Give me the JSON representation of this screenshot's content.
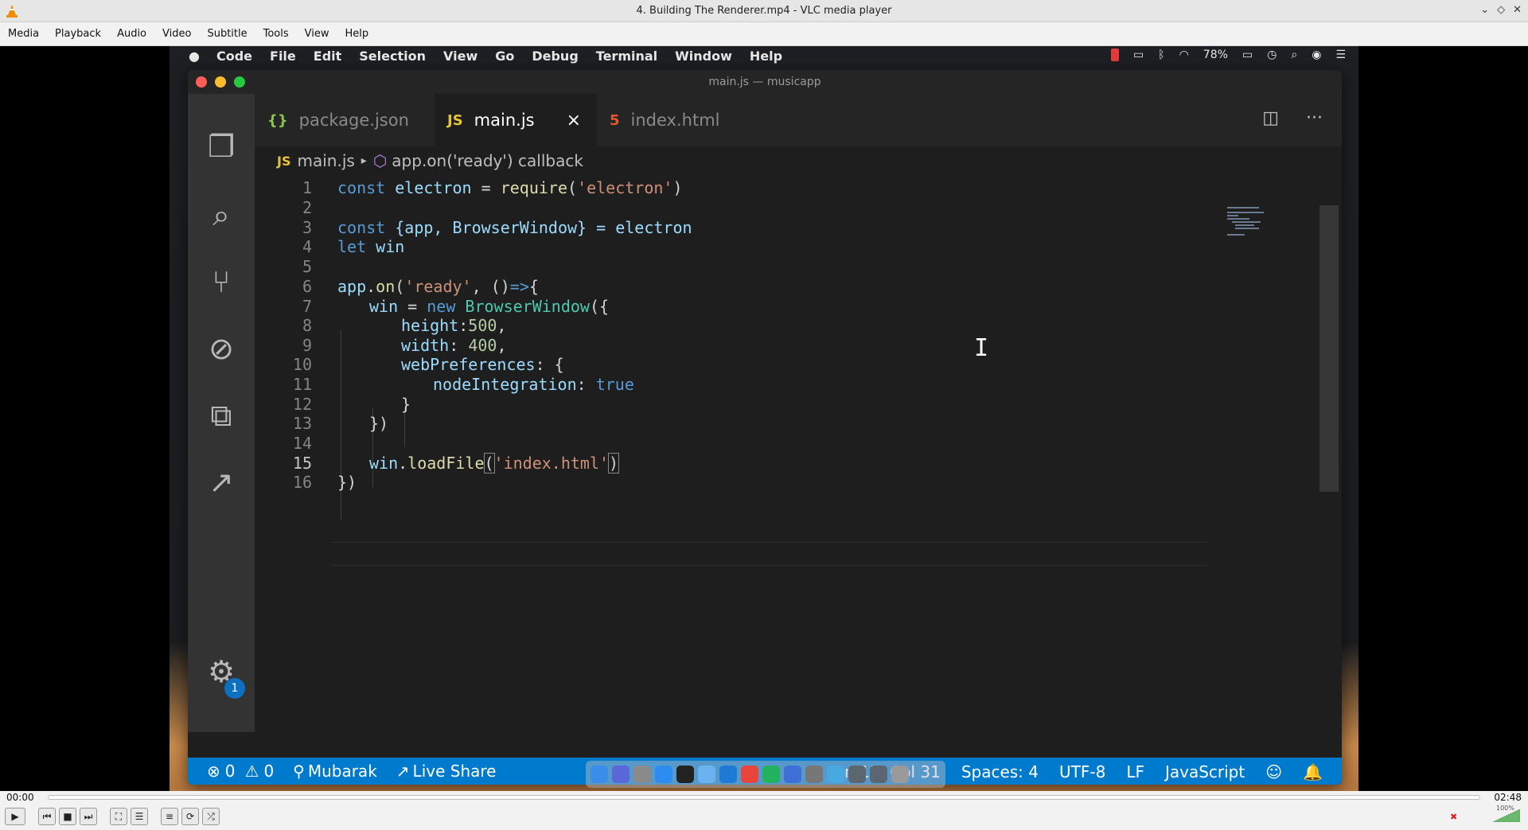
{
  "vlc": {
    "window_title": "4. Building The Renderer.mp4 - VLC media player",
    "menus": [
      "Media",
      "Playback",
      "Audio",
      "Video",
      "Subtitle",
      "Tools",
      "View",
      "Help"
    ],
    "time_current": "00:00",
    "time_total": "02:48",
    "volume_label": "100%",
    "window_buttons": [
      "⌄",
      "◇",
      "✕"
    ]
  },
  "mac_menubar": {
    "app": "Code",
    "items": [
      "File",
      "Edit",
      "Selection",
      "View",
      "Go",
      "Debug",
      "Terminal",
      "Window",
      "Help"
    ],
    "battery": "78%"
  },
  "vscode": {
    "window_title": "main.js — musicapp",
    "tabs": [
      {
        "label": "package.json",
        "icon": "json-icon"
      },
      {
        "label": "main.js",
        "icon": "js-icon",
        "active": true
      },
      {
        "label": "index.html",
        "icon": "html-icon"
      }
    ],
    "breadcrumb": {
      "file": "main.js",
      "symbol": "app.on('ready') callback"
    },
    "line_numbers": [
      "1",
      "2",
      "3",
      "4",
      "5",
      "6",
      "7",
      "8",
      "9",
      "10",
      "11",
      "12",
      "13",
      "14",
      "15",
      "16"
    ],
    "code": {
      "l1": [
        "const",
        " ",
        "electron",
        " = ",
        "require",
        "(",
        "'electron'",
        ")"
      ],
      "l3": [
        "const",
        " {app, BrowserWindow} = electron"
      ],
      "l4": [
        "let",
        " win"
      ],
      "l6": [
        "app",
        ".",
        "on",
        "(",
        "'ready'",
        ", ()",
        "=>",
        "{"
      ],
      "l7": [
        "win",
        " = ",
        "new",
        " ",
        "BrowserWindow",
        "({"
      ],
      "l8": [
        "height",
        ":",
        "500",
        ","
      ],
      "l9": [
        "width",
        ": ",
        "400",
        ","
      ],
      "l10": [
        "webPreferences",
        ": {"
      ],
      "l11": [
        "nodeIntegration",
        ": ",
        "true"
      ],
      "l12": "}",
      "l13": "})",
      "l15": [
        "win",
        ".",
        "loadFile",
        "(",
        "'index.html'",
        ")"
      ],
      "l16": "})"
    },
    "status": {
      "errors": "0",
      "warnings": "0",
      "branch": "Mubarak",
      "live_share": "Live Share",
      "position": "Ln 15, Col 31",
      "spaces": "Spaces: 4",
      "encoding": "UTF-8",
      "eol": "LF",
      "language": "JavaScript"
    },
    "settings_badge": "1"
  }
}
